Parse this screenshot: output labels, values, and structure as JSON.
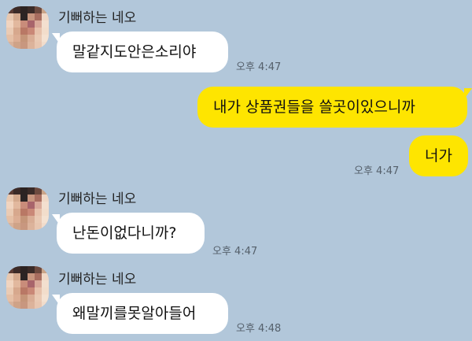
{
  "colors": {
    "background": "#b2c7da",
    "incoming_bubble": "#ffffff",
    "outgoing_bubble": "#fee500"
  },
  "messages": [
    {
      "direction": "in",
      "sender": "기뻐하는 네오",
      "text": "말같지도안은소리야",
      "time": "오후 4:47"
    },
    {
      "direction": "out",
      "text": "내가 상품권들을 쓸곳이있으니까"
    },
    {
      "direction": "out",
      "text": "너가",
      "time": "오후 4:47"
    },
    {
      "direction": "in",
      "sender": "기뻐하는 네오",
      "text": "난돈이없다니까?",
      "time": "오후 4:47"
    },
    {
      "direction": "in",
      "sender": "기뻐하는 네오",
      "text": "왜말끼를못알아들어",
      "time": "오후 4:48"
    }
  ]
}
